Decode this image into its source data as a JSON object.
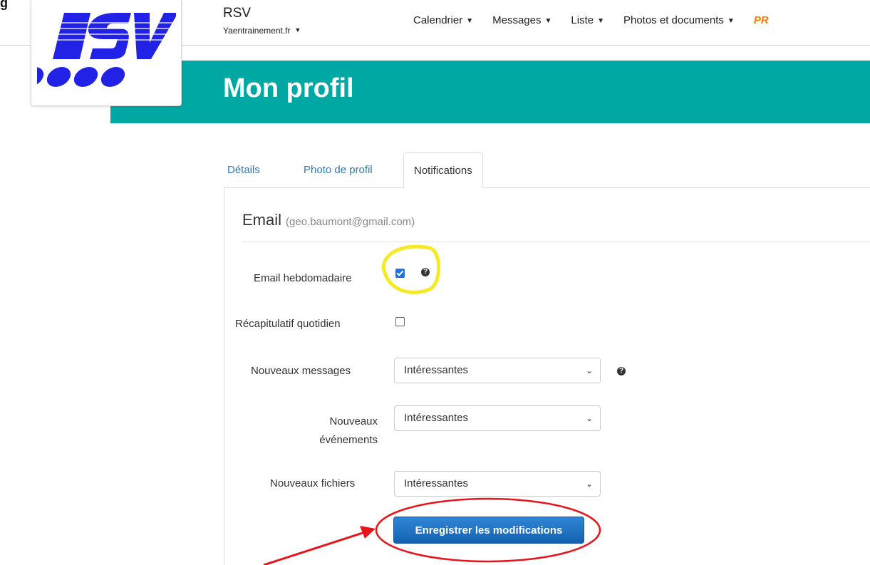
{
  "page": {
    "corner_text": "g"
  },
  "brand": {
    "title": "RSV",
    "site": "Yaentrainement.fr",
    "caret": "▼"
  },
  "nav": {
    "items": [
      {
        "label": "Calendrier",
        "caret": "▼"
      },
      {
        "label": "Messages",
        "caret": "▼"
      },
      {
        "label": "Liste",
        "caret": "▼"
      },
      {
        "label": "Photos et documents",
        "caret": "▼"
      }
    ],
    "pro_label": "PR"
  },
  "banner": {
    "title": "Mon profil"
  },
  "tabs": [
    {
      "label": "Détails",
      "active": false
    },
    {
      "label": "Photo de profil",
      "active": false
    },
    {
      "label": "Notifications",
      "active": true
    }
  ],
  "email_section": {
    "title": "Email",
    "address": "(geo.baumont@gmail.com)"
  },
  "fields": {
    "weekly_email": {
      "label": "Email hebdomadaire",
      "checked": true,
      "help": "?"
    },
    "daily_summary": {
      "label": "Récapitulatif quotidien",
      "checked": false
    },
    "new_messages": {
      "label": "Nouveaux messages",
      "value": "Intéressantes",
      "help": "?"
    },
    "new_events": {
      "label_line1": "Nouveaux",
      "label_line2": "événements",
      "value": "Intéressantes"
    },
    "new_files": {
      "label": "Nouveaux fichiers",
      "value": "Intéressantes"
    }
  },
  "select_chevron": "⌄",
  "save_button": {
    "label": "Enregistrer les modifications"
  },
  "colors": {
    "banner": "#00a8a3",
    "button": "#1a6cc4",
    "pro": "#ff7a00",
    "highlight": "#f5e81b",
    "annotation": "#e8141b"
  }
}
